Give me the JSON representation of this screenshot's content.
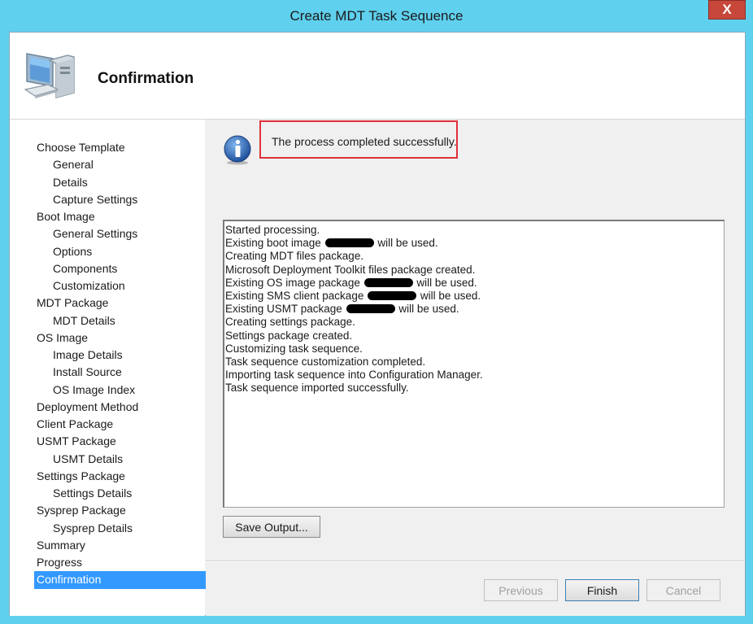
{
  "window": {
    "title": "Create MDT Task Sequence",
    "close_glyph": "X"
  },
  "header": {
    "title": "Confirmation",
    "icon": "computer-icon"
  },
  "nav": {
    "items": [
      {
        "label": "Choose Template",
        "level": 0
      },
      {
        "label": "General",
        "level": 1
      },
      {
        "label": "Details",
        "level": 1
      },
      {
        "label": "Capture Settings",
        "level": 1
      },
      {
        "label": "Boot Image",
        "level": 0
      },
      {
        "label": "General Settings",
        "level": 1
      },
      {
        "label": "Options",
        "level": 1
      },
      {
        "label": "Components",
        "level": 1
      },
      {
        "label": "Customization",
        "level": 1
      },
      {
        "label": "MDT Package",
        "level": 0
      },
      {
        "label": "MDT Details",
        "level": 1
      },
      {
        "label": "OS Image",
        "level": 0
      },
      {
        "label": "Image Details",
        "level": 1
      },
      {
        "label": "Install Source",
        "level": 1
      },
      {
        "label": "OS Image Index",
        "level": 1
      },
      {
        "label": "Deployment Method",
        "level": 0
      },
      {
        "label": "Client Package",
        "level": 0
      },
      {
        "label": "USMT Package",
        "level": 0
      },
      {
        "label": "USMT Details",
        "level": 1
      },
      {
        "label": "Settings Package",
        "level": 0
      },
      {
        "label": "Settings Details",
        "level": 1
      },
      {
        "label": "Sysprep Package",
        "level": 0
      },
      {
        "label": "Sysprep Details",
        "level": 1
      },
      {
        "label": "Summary",
        "level": 0
      },
      {
        "label": "Progress",
        "level": 0
      },
      {
        "label": "Confirmation",
        "level": 0,
        "active": true
      }
    ]
  },
  "status": {
    "message": "The process completed successfully.",
    "icon": "info-icon"
  },
  "log": {
    "lines": [
      {
        "before": "Started processing."
      },
      {
        "before": "Existing boot image ",
        "redacted": true,
        "after": " will be used."
      },
      {
        "before": "Creating MDT files package."
      },
      {
        "before": "Microsoft Deployment Toolkit files package created."
      },
      {
        "before": "Existing OS image package ",
        "redacted": true,
        "after": " will be used."
      },
      {
        "before": "Existing SMS client package ",
        "redacted": true,
        "after": " will be used."
      },
      {
        "before": "Existing USMT package ",
        "redacted": true,
        "after": " will be used."
      },
      {
        "before": "Creating settings package."
      },
      {
        "before": "Settings package created."
      },
      {
        "before": "Customizing task sequence."
      },
      {
        "before": "Task sequence customization completed."
      },
      {
        "before": "Importing task sequence into Configuration Manager."
      },
      {
        "before": "Task sequence imported successfully."
      }
    ]
  },
  "buttons": {
    "save_output": "Save Output...",
    "previous": "Previous",
    "finish": "Finish",
    "cancel": "Cancel"
  },
  "colors": {
    "titlebar": "#5fd0ee",
    "selection": "#3399ff",
    "highlight": "#e0303a",
    "close": "#c7473a"
  }
}
